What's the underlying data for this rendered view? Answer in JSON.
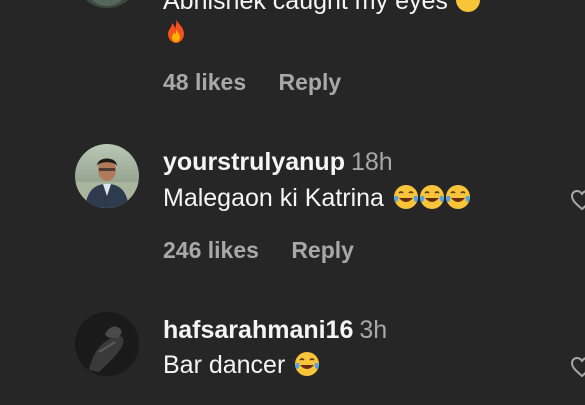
{
  "comments": [
    {
      "text_partial": "Abhishek caught my eyes",
      "text_emoji_line": "🔥",
      "likes": "48 likes",
      "reply": "Reply"
    },
    {
      "username": "yourstrulyanup",
      "time": "18h",
      "text": "Malegaon ki Katrina",
      "likes": "246 likes",
      "reply": "Reply"
    },
    {
      "username": "hafsarahmani16",
      "time": "3h",
      "text": "Bar dancer"
    }
  ],
  "icons": {
    "like": "heart-icon",
    "laugh": "face-with-tears-of-joy-emoji",
    "fire": "fire-emoji"
  }
}
